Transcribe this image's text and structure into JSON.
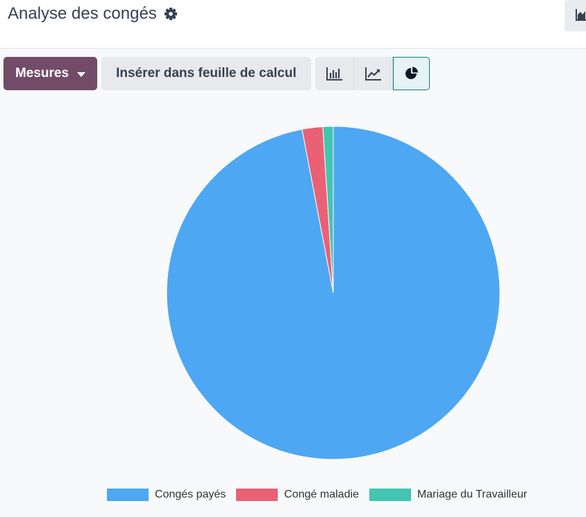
{
  "header": {
    "title": "Analyse des congés"
  },
  "toolbar": {
    "measures_label": "Mesures",
    "insert_label": "Insérer dans feuille de calcul",
    "views": [
      {
        "name": "bar-chart-view",
        "active": false
      },
      {
        "name": "line-chart-view",
        "active": false
      },
      {
        "name": "pie-chart-view",
        "active": true
      }
    ]
  },
  "colors": {
    "primary": "#714b67",
    "active_border": "#017e84"
  },
  "chart_data": {
    "type": "pie",
    "categories": [
      "Congés payés",
      "Congé maladie",
      "Mariage du Travailleur"
    ],
    "values": [
      97,
      2,
      1
    ],
    "colors": [
      "#4ea7f2",
      "#ea6175",
      "#43c5b1"
    ],
    "legend": "bottom"
  }
}
